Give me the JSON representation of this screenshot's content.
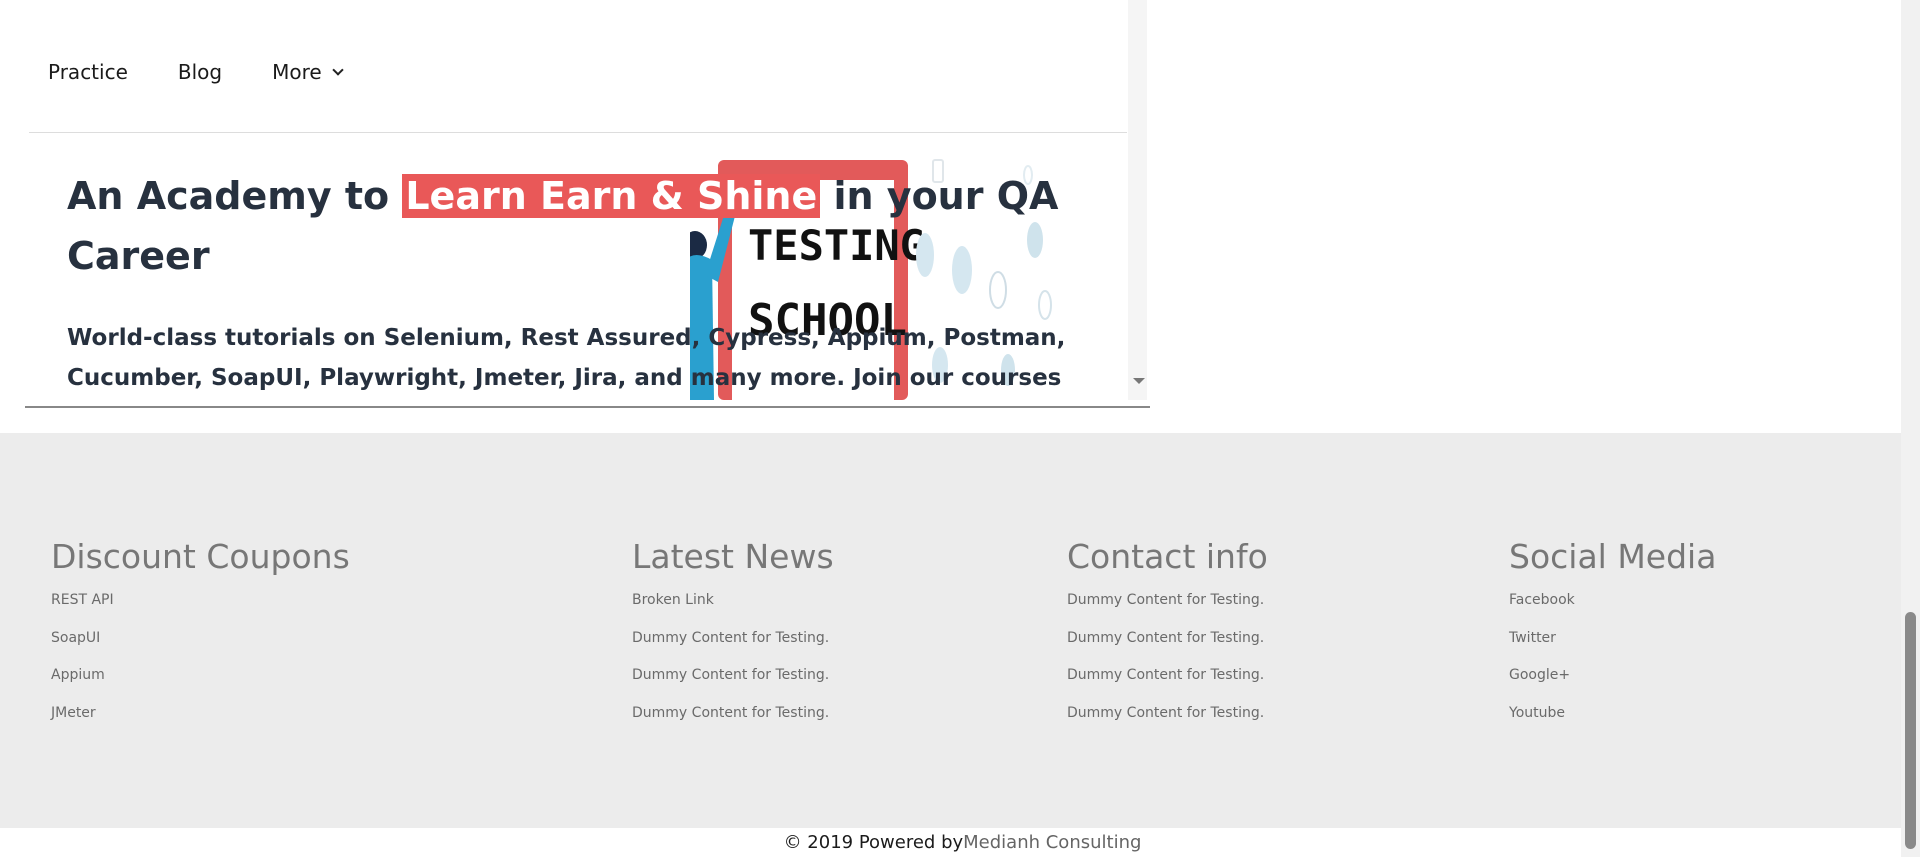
{
  "nav": {
    "items": [
      {
        "label": "Practice"
      },
      {
        "label": "Blog"
      },
      {
        "label": "More"
      }
    ]
  },
  "hero": {
    "title_before": "An Academy to ",
    "title_highlight": "Learn Earn & Shine",
    "title_after": "  in your QA Career",
    "subtitle": "World-class tutorials on Selenium, Rest Assured, Cypress, Appium, Postman, Cucumber, SoapUI, Playwright, Jmeter, Jira, and many more. Join our courses now to get the best job",
    "image_text_1": "TESTING",
    "image_text_2": "SCHOOL",
    "highlight_color": "#e95858"
  },
  "footer": {
    "columns": [
      {
        "title": "Discount Coupons",
        "links": [
          "REST API",
          "SoapUI",
          "Appium",
          "JMeter"
        ]
      },
      {
        "title": "Latest News",
        "links": [
          "Broken Link",
          "Dummy Content for Testing.",
          "Dummy Content for Testing.",
          "Dummy Content for Testing."
        ]
      },
      {
        "title": "Contact info",
        "links": [
          "Dummy Content for Testing.",
          "Dummy Content for Testing.",
          "Dummy Content for Testing.",
          "Dummy Content for Testing."
        ]
      },
      {
        "title": "Social Media",
        "links": [
          "Facebook",
          "Twitter",
          "Google+",
          "Youtube"
        ]
      }
    ],
    "copyright_prefix": "© 2019 Powered by ",
    "copyright_link": "Medianh Consulting"
  }
}
